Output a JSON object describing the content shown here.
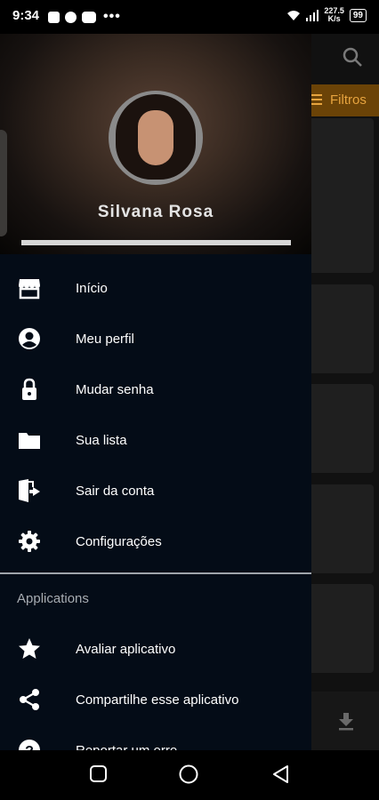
{
  "status_bar": {
    "time": "9:34",
    "dots": "•••",
    "net_speed_value": "227.5",
    "net_speed_unit": "K/s",
    "battery": "99"
  },
  "background": {
    "filter_label": "Filtros"
  },
  "drawer": {
    "header": {
      "user_name": "Silvana Rosa",
      "progress_fraction": 1.0
    },
    "main_items": [
      {
        "label": "Início",
        "icon": "store-icon"
      },
      {
        "label": "Meu perfil",
        "icon": "account-circle-icon"
      },
      {
        "label": "Mudar senha",
        "icon": "lock-icon"
      },
      {
        "label": "Sua lista",
        "icon": "folder-icon"
      },
      {
        "label": "Sair da conta",
        "icon": "exit-door-icon"
      },
      {
        "label": "Configurações",
        "icon": "gear-icon"
      }
    ],
    "section_title": "Applications",
    "app_items": [
      {
        "label": "Avaliar aplicativo",
        "icon": "star-icon"
      },
      {
        "label": "Compartilhe esse aplicativo",
        "icon": "share-icon"
      },
      {
        "label": "Reportar um erro",
        "icon": "help-icon"
      }
    ]
  },
  "colors": {
    "drawer_bg": "#040c17",
    "filter_bg": "#6b4307",
    "filter_text": "#e7a43f"
  }
}
